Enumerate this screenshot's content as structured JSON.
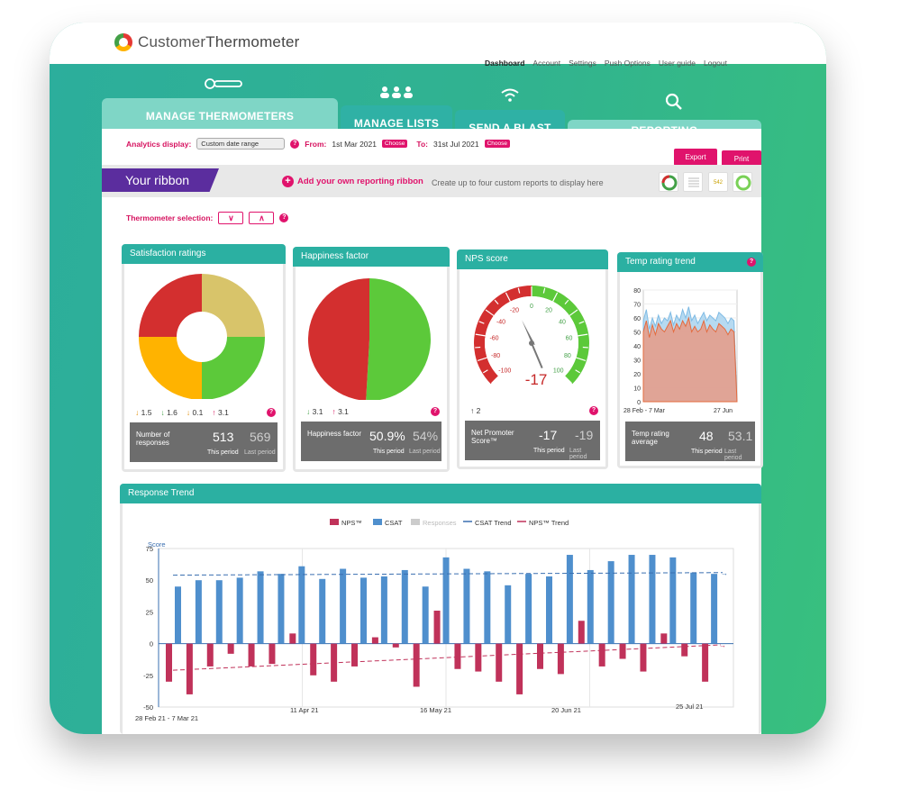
{
  "app": {
    "brand_part1": "Customer",
    "brand_part2": "Thermometer"
  },
  "topnav": [
    "Dashboard",
    "Account",
    "Settings",
    "Push Options",
    "User guide",
    "Logout"
  ],
  "tabs": [
    "MANAGE THERMOMETERS",
    "MANAGE LISTS",
    "SEND A BLAST",
    "REPORTING"
  ],
  "analytics": {
    "label": "Analytics display:",
    "select_value": "Custom date range",
    "from_label": "From:",
    "from_value": "1st Mar 2021",
    "to_label": "To:",
    "to_value": "31st Jul 2021",
    "choose": "Choose",
    "export": "Export",
    "print": "Print"
  },
  "ribbon": {
    "title": "Your ribbon",
    "add_label": "Add your own reporting ribbon",
    "hint": "Create up to four custom reports to display here",
    "mini_value": "542"
  },
  "thermometer_selection": {
    "label": "Thermometer selection:",
    "down": "∨",
    "up": "∧"
  },
  "qmark": "?",
  "cards": {
    "satisfaction": {
      "title": "Satisfaction ratings",
      "changes": [
        {
          "arrow": "↓",
          "value": "1.5",
          "color": "#e08a00"
        },
        {
          "arrow": "↓",
          "value": "1.6",
          "color": "#43a047"
        },
        {
          "arrow": "↓",
          "value": "0.1",
          "color": "#e08a00"
        },
        {
          "arrow": "↑",
          "value": "3.1",
          "color": "#d81b60"
        }
      ],
      "stat_label": "Number of responses",
      "this_value": "513",
      "last_value": "569",
      "this_label": "This period",
      "last_label": "Last period"
    },
    "happiness": {
      "title": "Happiness factor",
      "changes": [
        {
          "arrow": "↓",
          "value": "3.1",
          "color": "#43a047"
        },
        {
          "arrow": "↑",
          "value": "3.1",
          "color": "#d81b60"
        }
      ],
      "stat_label": "Happiness factor",
      "this_value": "50.9%",
      "last_value": "54%",
      "this_label": "This period",
      "last_label": "Last period"
    },
    "nps": {
      "title": "NPS score",
      "changes": [
        {
          "arrow": "↑",
          "value": "2",
          "color": "#333"
        }
      ],
      "gauge_value": "-17",
      "stat_label": "Net Promoter Score™",
      "this_value": "-17",
      "last_value": "-19",
      "this_label": "This period",
      "last_label": "Last period"
    },
    "temp": {
      "title": "Temp rating trend",
      "stat_label": "Temp rating average",
      "this_value": "48",
      "last_value": "53.1",
      "this_label": "This period",
      "last_label": "Last period"
    }
  },
  "colors": {
    "teal": "#2bb0a2",
    "pink": "#e0136c",
    "red": "#d32f2f",
    "green": "#5cc93a",
    "orange": "#ffb300",
    "gold": "#d8c46a",
    "nps_bar": "#c0325a",
    "csat_bar": "#4f8fcd"
  },
  "chart_data": [
    {
      "type": "pie",
      "title": "Satisfaction ratings",
      "values": [
        25,
        25,
        25,
        25
      ],
      "colors": [
        "#d8c46a",
        "#5cc93a",
        "#ffb300",
        "#d32f2f"
      ],
      "donut": true
    },
    {
      "type": "pie",
      "title": "Happiness factor",
      "values": [
        50.9,
        49.1
      ],
      "colors": [
        "#5cc93a",
        "#d32f2f"
      ]
    },
    {
      "type": "gauge",
      "title": "NPS score",
      "value": -17,
      "range": [
        -100,
        100
      ],
      "ticks": [
        "-100",
        "-80",
        "-60",
        "-40",
        "-20",
        "0",
        "20",
        "40",
        "60",
        "80",
        "100"
      ]
    },
    {
      "type": "area",
      "title": "Temp rating trend",
      "ylim": [
        0,
        80
      ],
      "yticks": [
        "0",
        "10",
        "20",
        "30",
        "40",
        "50",
        "60",
        "70",
        "80"
      ],
      "xlabels": [
        "28 Feb - 7 Mar",
        "27 Jun"
      ],
      "series": [
        {
          "values": [
            58,
            66,
            52,
            60,
            54,
            62,
            56,
            60,
            58,
            64,
            55,
            62,
            58,
            66,
            60,
            68,
            58,
            62,
            56,
            60,
            64,
            58,
            62,
            60,
            58,
            64,
            62,
            60,
            56,
            60,
            58,
            0
          ],
          "color": "#a9d4ee"
        },
        {
          "values": [
            50,
            58,
            46,
            55,
            48,
            56,
            52,
            50,
            54,
            58,
            50,
            56,
            52,
            58,
            54,
            60,
            50,
            54,
            50,
            52,
            58,
            50,
            55,
            52,
            50,
            56,
            54,
            52,
            48,
            52,
            50,
            0
          ],
          "color": "#e89a86"
        }
      ]
    },
    {
      "type": "bar",
      "title": "Response Trend",
      "ylabel": "Score",
      "ylim": [
        -50,
        75
      ],
      "yticks": [
        "75",
        "50",
        "25",
        "0",
        "-25",
        "-50"
      ],
      "legend": [
        "NPS™",
        "CSAT",
        "Responses",
        "CSAT Trend",
        "NPS™ Trend"
      ],
      "xlabels": [
        "28 Feb 21 - 7 Mar 21",
        "11 Apr 21",
        "16 May 21",
        "20 Jun 21",
        "25 Jul 21"
      ],
      "series": [
        {
          "name": "NPS™",
          "values": [
            -30,
            -40,
            -18,
            -8,
            -18,
            -16,
            8,
            -25,
            -30,
            -18,
            5,
            -3,
            -34,
            26,
            -20,
            -22,
            -30,
            -40,
            -20,
            -24,
            18,
            -18,
            -12,
            -22,
            8,
            -10,
            -30
          ]
        },
        {
          "name": "CSAT",
          "values": [
            45,
            50,
            50,
            52,
            57,
            55,
            61,
            51,
            59,
            52,
            53,
            58,
            45,
            68,
            59,
            57,
            46,
            55,
            53,
            70,
            58,
            65,
            70,
            70,
            68,
            56,
            55
          ]
        }
      ]
    }
  ]
}
